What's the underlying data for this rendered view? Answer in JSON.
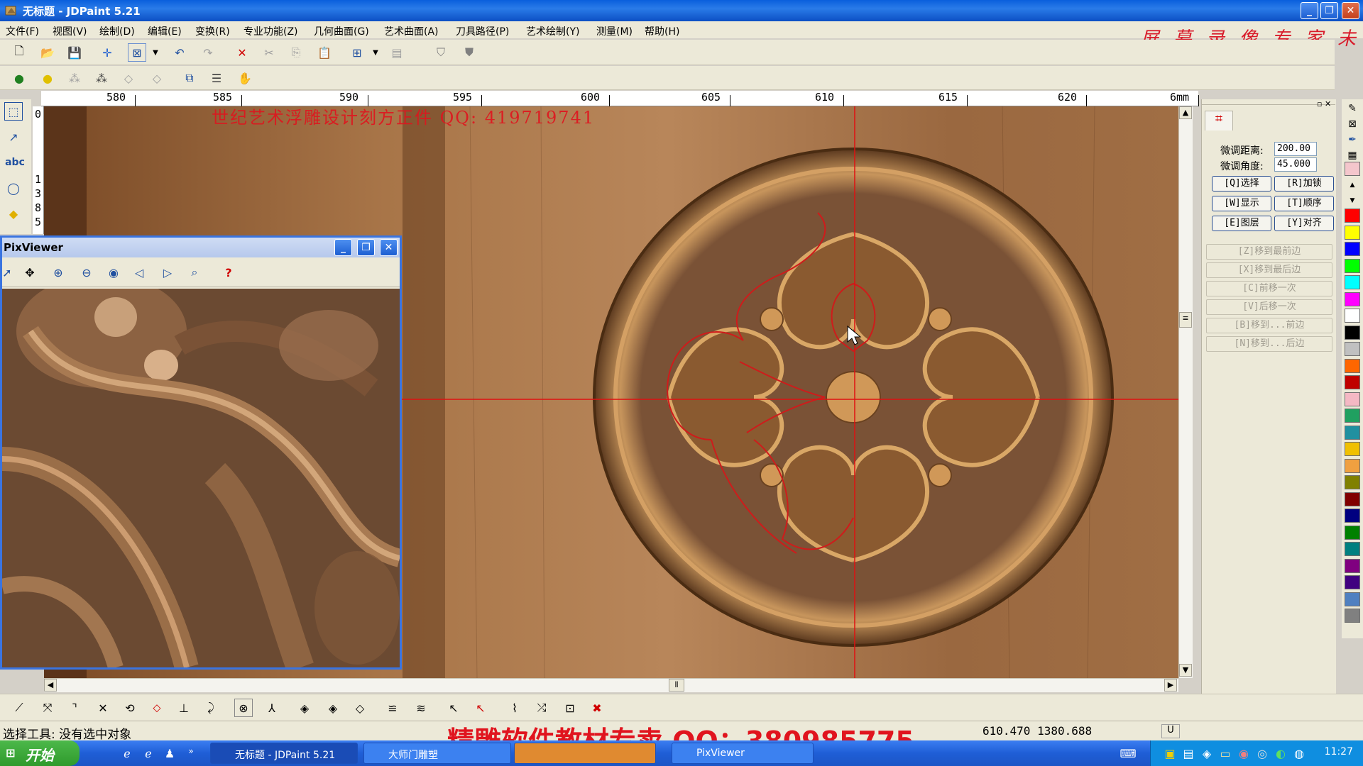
{
  "window": {
    "title": "无标题 - JDPaint 5.21",
    "minimize_glyph": "_",
    "maximize_glyph": "❐",
    "close_glyph": "✕"
  },
  "menu": [
    "文件(F)",
    "视图(V)",
    "绘制(D)",
    "编辑(E)",
    "变换(R)",
    "专业功能(Z)",
    "几何曲面(G)",
    "艺术曲面(A)",
    "刀具路径(P)",
    "艺术绘制(Y)",
    "测量(M)",
    "帮助(H)"
  ],
  "watermark_top": "屏 幕 录 像 专 家 未",
  "canvas_overlay_text": "世纪艺术浮雕设计刻方正件 QQ: 419719741",
  "ruler": {
    "h_labels": [
      "580",
      "585",
      "590",
      "595",
      "600",
      "605",
      "610",
      "615",
      "620",
      "6mm"
    ],
    "v_labels": [
      "0",
      "1",
      "3",
      "8",
      "5"
    ]
  },
  "pixviewer": {
    "title": "PixViewer",
    "help_glyph": "?"
  },
  "right_panel": {
    "fine_distance_label": "微调距离:",
    "fine_distance_value": "200.00",
    "fine_angle_label": "微调角度:",
    "fine_angle_value": "45.000",
    "buttons": [
      "[Q]选择",
      "[R]加锁",
      "[W]显示",
      "[T]顺序",
      "[E]图层",
      "[Y]对齐"
    ],
    "order_buttons": [
      "[Z]移到最前边",
      "[X]移到最后边",
      "[C]前移一次",
      "[V]后移一次",
      "[B]移到...前边",
      "[N]移到...后边"
    ]
  },
  "palette_colors": [
    "#f4c6cc",
    "#ff0000",
    "#ffff00",
    "#0000ff",
    "#00ff00",
    "#00ffff",
    "#ff00ff",
    "#ffffff",
    "#000000",
    "#c0c0c0",
    "#ff6600",
    "#c00000",
    "#f4b8c4",
    "#20a060",
    "#2090a0",
    "#f0c000",
    "#f0a040",
    "#808000",
    "#800000",
    "#000080",
    "#008000",
    "#008080",
    "#800080",
    "#400080",
    "#5080c0",
    "#808080"
  ],
  "status": {
    "tool_text": "选择工具: 没有选中对象",
    "coords": "610.470  1380.688",
    "mode": "U"
  },
  "watermark_bottom": "精雕软件教材专卖 QQ：380985775",
  "taskbar": {
    "start": "开始",
    "tasks": [
      "无标题 - JDPaint 5.21",
      "大师门雕塑",
      "",
      "PixViewer"
    ],
    "clock": "11:27"
  },
  "colors": {
    "accent_red": "#e0141e",
    "xp_blue": "#0a5fdc",
    "crosshair": "#e01010"
  }
}
